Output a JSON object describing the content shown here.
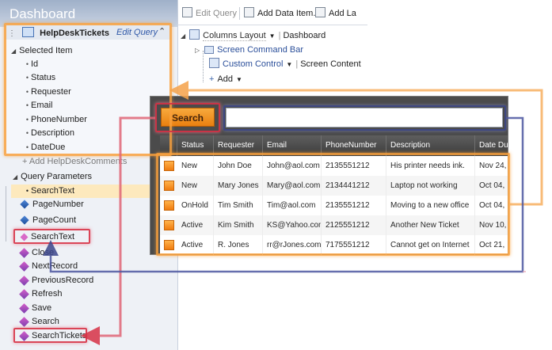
{
  "designer": {
    "title": "Dashboard",
    "entity": {
      "name": "HelpDeskTickets",
      "edit_query": "Edit Query",
      "selected_item_label": "Selected Item",
      "fields": [
        "Id",
        "Status",
        "Requester",
        "Email",
        "PhoneNumber",
        "Description",
        "DateDue"
      ],
      "add_related": "+ Add HelpDeskComments"
    },
    "query_parameters": {
      "label": "Query Parameters",
      "param": "SearchText"
    },
    "properties": [
      "PageNumber",
      "PageCount",
      "SearchText"
    ],
    "methods": [
      "Close",
      "NextRecord",
      "PreviousRecord",
      "Refresh",
      "Save",
      "Search",
      "SearchTickets"
    ]
  },
  "toolbar": {
    "edit_query": "Edit Query",
    "add_data_item": "Add Data Item...",
    "add_layout": "Add La"
  },
  "layout_tree": {
    "columns_layout": "Columns Layout",
    "dashboard": "Dashboard",
    "screen_command_bar": "Screen Command Bar",
    "custom_control": "Custom Control",
    "screen_content": "Screen Content",
    "add": "Add"
  },
  "app": {
    "search_button": "Search",
    "search_value": "",
    "columns": [
      "Status",
      "Requester",
      "Email",
      "PhoneNumber",
      "Description",
      "Date Du"
    ],
    "rows": [
      [
        "New",
        "John Doe",
        "John@aol.com",
        "2135551212",
        "His printer needs ink.",
        "Nov 24, "
      ],
      [
        "New",
        "Mary Jones",
        "Mary@aol.com",
        "2134441212",
        "Laptop not working",
        "Oct 04, "
      ],
      [
        "OnHold",
        "Tim Smith",
        "Tim@aol.com",
        "2135551212",
        "Moving to a new office",
        "Oct 04, "
      ],
      [
        "Active",
        "Kim Smith",
        "KS@Yahoo.com",
        "2125551212",
        "Another New Ticket",
        "Nov 10, "
      ],
      [
        "Active",
        "R. Jones",
        "rr@rJones.com",
        "7175551212",
        "Cannot get on Internet",
        "Oct 21, "
      ]
    ]
  },
  "colors": {
    "highlight_orange": "#f8a03c",
    "highlight_blue": "#3c468c",
    "highlight_red": "#d73246",
    "accent_button": "#f29020"
  }
}
